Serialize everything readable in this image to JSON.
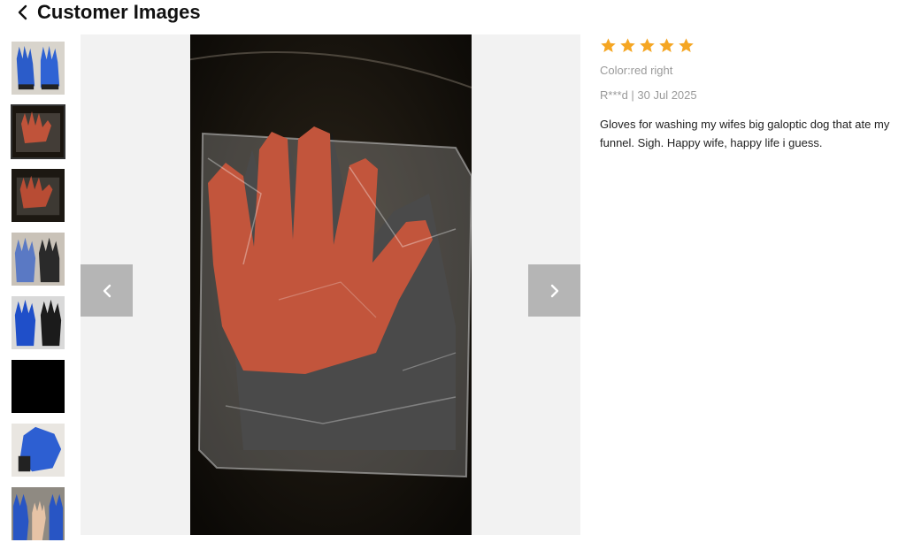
{
  "header": {
    "title": "Customer Images",
    "back_icon": "chevron-left-icon"
  },
  "gallery": {
    "thumbnail_count": 8,
    "selected_index": 1,
    "prev_icon": "chevron-left-icon",
    "next_icon": "chevron-right-icon"
  },
  "review": {
    "rating": 5,
    "max_rating": 5,
    "star_color": "#f5a623",
    "color_text": "Color:red right",
    "meta": "R***d | 30 Jul 2025",
    "body": "Gloves for washing my wifes big galoptic dog that ate my funnel. Sigh. Happy wife, happy life i guess."
  }
}
